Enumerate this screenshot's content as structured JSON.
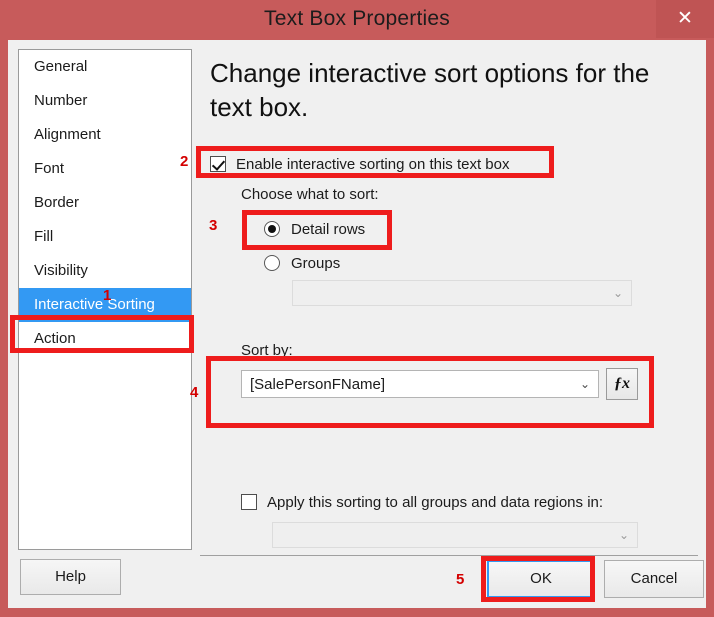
{
  "window": {
    "title": "Text Box Properties",
    "close_label": "✕",
    "titlebar_color": "#c75b5b",
    "close_button_color": "#bf5454"
  },
  "sidebar": {
    "items": [
      {
        "label": "General",
        "selected": false
      },
      {
        "label": "Number",
        "selected": false
      },
      {
        "label": "Alignment",
        "selected": false
      },
      {
        "label": "Font",
        "selected": false
      },
      {
        "label": "Border",
        "selected": false
      },
      {
        "label": "Fill",
        "selected": false
      },
      {
        "label": "Visibility",
        "selected": false
      },
      {
        "label": "Interactive Sorting",
        "selected": true
      },
      {
        "label": "Action",
        "selected": false
      }
    ],
    "selected_color": "#3399f3"
  },
  "content": {
    "heading": "Change interactive sort options for the text box.",
    "enable_sorting": {
      "label": "Enable interactive sorting on this text box",
      "checked": true
    },
    "choose_what_to_sort": {
      "label": "Choose what to sort:",
      "options": [
        {
          "label": "Detail rows",
          "selected": true
        },
        {
          "label": "Groups",
          "selected": false
        }
      ],
      "groups_combo": {
        "value": "",
        "disabled": true,
        "arrow": "⌄"
      }
    },
    "sort_by": {
      "label": "Sort by:",
      "value": "[SalePersonFName]",
      "arrow": "⌄",
      "expression_button_label": "ƒx"
    },
    "apply_to_all": {
      "label": "Apply this sorting to all groups and data regions in:",
      "checked": false,
      "combo": {
        "value": "",
        "disabled": true,
        "arrow": "⌄"
      }
    }
  },
  "footer": {
    "help_label": "Help",
    "ok_label": "OK",
    "cancel_label": "Cancel",
    "focus_color": "#3399f3"
  },
  "annotations": {
    "color": "#ee1c1c",
    "number_color": "#d40000",
    "steps": [
      {
        "number": "1",
        "target": "sidebar-item-interactive-sorting"
      },
      {
        "number": "2",
        "target": "enable-interactive-sorting-checkbox"
      },
      {
        "number": "3",
        "target": "detail-rows-radio"
      },
      {
        "number": "4",
        "target": "sort-by-group"
      },
      {
        "number": "5",
        "target": "ok-button"
      }
    ]
  }
}
